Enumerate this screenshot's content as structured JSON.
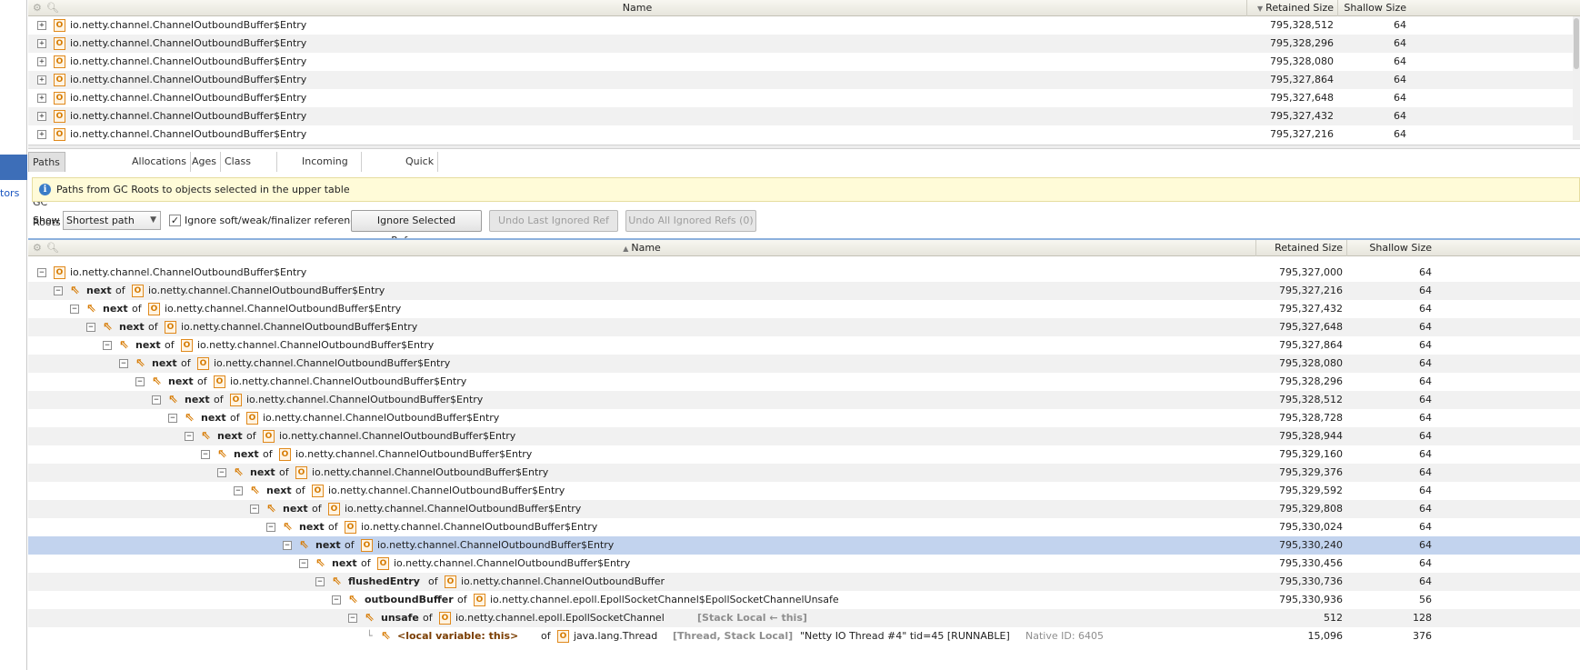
{
  "sidebar": {
    "link_fragment": "tors"
  },
  "upper_table": {
    "columns": {
      "name": "Name",
      "retained": "Retained Size",
      "shallow": "Shallow Size"
    },
    "rows": [
      {
        "name": "io.netty.channel.ChannelOutboundBuffer$Entry",
        "retained": "795,328,512",
        "shallow": "64"
      },
      {
        "name": "io.netty.channel.ChannelOutboundBuffer$Entry",
        "retained": "795,328,296",
        "shallow": "64"
      },
      {
        "name": "io.netty.channel.ChannelOutboundBuffer$Entry",
        "retained": "795,328,080",
        "shallow": "64"
      },
      {
        "name": "io.netty.channel.ChannelOutboundBuffer$Entry",
        "retained": "795,327,864",
        "shallow": "64"
      },
      {
        "name": "io.netty.channel.ChannelOutboundBuffer$Entry",
        "retained": "795,327,648",
        "shallow": "64"
      },
      {
        "name": "io.netty.channel.ChannelOutboundBuffer$Entry",
        "retained": "795,327,432",
        "shallow": "64"
      },
      {
        "name": "io.netty.channel.ChannelOutboundBuffer$Entry",
        "retained": "795,327,216",
        "shallow": "64"
      }
    ]
  },
  "tabs": [
    {
      "label": "Paths from GC Roots",
      "active": true
    },
    {
      "label": "Allocations"
    },
    {
      "label": "Ages"
    },
    {
      "label": "Class Hierarchy"
    },
    {
      "label": "Incoming References"
    },
    {
      "label": "Quick Info"
    }
  ],
  "info_text": "Paths from GC Roots to objects selected in the upper table",
  "controls": {
    "show_label": "Show",
    "show_value": "Shortest path",
    "ignore_checkbox_label": "Ignore soft/weak/finalizer references",
    "ignore_checked": true,
    "buttons": {
      "ignore_selected": "Ignore Selected Reference",
      "undo_last": "Undo Last Ignored Ref",
      "undo_all": "Undo All Ignored Refs (0)"
    }
  },
  "lower_table": {
    "columns": {
      "name": "Name",
      "retained": "Retained Size",
      "shallow": "Shallow Size"
    },
    "rows": [
      {
        "field": "",
        "of": "",
        "class": "io.netty.channel.ChannelOutboundBuffer$Entry",
        "extra": "",
        "note": "",
        "retained": "795,327,000",
        "shallow": "64"
      },
      {
        "field": "next",
        "of": "of",
        "class": "io.netty.channel.ChannelOutboundBuffer$Entry",
        "extra": "",
        "note": "",
        "retained": "795,327,216",
        "shallow": "64"
      },
      {
        "field": "next",
        "of": "of",
        "class": "io.netty.channel.ChannelOutboundBuffer$Entry",
        "extra": "",
        "note": "",
        "retained": "795,327,432",
        "shallow": "64"
      },
      {
        "field": "next",
        "of": "of",
        "class": "io.netty.channel.ChannelOutboundBuffer$Entry",
        "extra": "",
        "note": "",
        "retained": "795,327,648",
        "shallow": "64"
      },
      {
        "field": "next",
        "of": "of",
        "class": "io.netty.channel.ChannelOutboundBuffer$Entry",
        "extra": "",
        "note": "",
        "retained": "795,327,864",
        "shallow": "64"
      },
      {
        "field": "next",
        "of": "of",
        "class": "io.netty.channel.ChannelOutboundBuffer$Entry",
        "extra": "",
        "note": "",
        "retained": "795,328,080",
        "shallow": "64"
      },
      {
        "field": "next",
        "of": "of",
        "class": "io.netty.channel.ChannelOutboundBuffer$Entry",
        "extra": "",
        "note": "",
        "retained": "795,328,296",
        "shallow": "64"
      },
      {
        "field": "next",
        "of": "of",
        "class": "io.netty.channel.ChannelOutboundBuffer$Entry",
        "extra": "",
        "note": "",
        "retained": "795,328,512",
        "shallow": "64"
      },
      {
        "field": "next",
        "of": "of",
        "class": "io.netty.channel.ChannelOutboundBuffer$Entry",
        "extra": "",
        "note": "",
        "retained": "795,328,728",
        "shallow": "64"
      },
      {
        "field": "next",
        "of": "of",
        "class": "io.netty.channel.ChannelOutboundBuffer$Entry",
        "extra": "",
        "note": "",
        "retained": "795,328,944",
        "shallow": "64"
      },
      {
        "field": "next",
        "of": "of",
        "class": "io.netty.channel.ChannelOutboundBuffer$Entry",
        "extra": "",
        "note": "",
        "retained": "795,329,160",
        "shallow": "64"
      },
      {
        "field": "next",
        "of": "of",
        "class": "io.netty.channel.ChannelOutboundBuffer$Entry",
        "extra": "",
        "note": "",
        "retained": "795,329,376",
        "shallow": "64"
      },
      {
        "field": "next",
        "of": "of",
        "class": "io.netty.channel.ChannelOutboundBuffer$Entry",
        "extra": "",
        "note": "",
        "retained": "795,329,592",
        "shallow": "64"
      },
      {
        "field": "next",
        "of": "of",
        "class": "io.netty.channel.ChannelOutboundBuffer$Entry",
        "extra": "",
        "note": "",
        "retained": "795,329,808",
        "shallow": "64"
      },
      {
        "field": "next",
        "of": "of",
        "class": "io.netty.channel.ChannelOutboundBuffer$Entry",
        "extra": "",
        "note": "",
        "retained": "795,330,024",
        "shallow": "64"
      },
      {
        "field": "next",
        "of": "of",
        "class": "io.netty.channel.ChannelOutboundBuffer$Entry",
        "extra": "",
        "note": "",
        "retained": "795,330,240",
        "shallow": "64",
        "selected": true
      },
      {
        "field": "next",
        "of": "of",
        "class": "io.netty.channel.ChannelOutboundBuffer$Entry",
        "extra": "",
        "note": "",
        "retained": "795,330,456",
        "shallow": "64"
      },
      {
        "field": "flushedEntry",
        "of": "of",
        "class": "io.netty.channel.ChannelOutboundBuffer",
        "extra": "",
        "note": "",
        "retained": "795,330,736",
        "shallow": "64"
      },
      {
        "field": "outboundBuffer",
        "of": "of",
        "class": "io.netty.channel.epoll.EpollSocketChannel$EpollSocketChannelUnsafe",
        "extra": "",
        "note": "",
        "retained": "795,330,936",
        "shallow": "56"
      },
      {
        "field": "unsafe",
        "of": "of",
        "class": "io.netty.channel.epoll.EpollSocketChannel",
        "extra": "[Stack Local ← this]",
        "note": "",
        "retained": "512",
        "shallow": "128"
      },
      {
        "field": "<local variable: this>",
        "of": "of",
        "class": "java.lang.Thread",
        "extra": "[Thread, Stack Local]",
        "note": "\"Netty IO Thread #4\" tid=45 [RUNNABLE]",
        "native": "Native ID: 6405",
        "retained": "15,096",
        "shallow": "376",
        "leaf": true
      }
    ]
  },
  "colors": {
    "selection": "#c2d3ee",
    "object_icon": "#e0891c",
    "sidebar_selected": "#3d6eb8",
    "info_bg": "#fffbd8"
  },
  "icons": {
    "settings": "gear-icon",
    "search": "search-icon",
    "object": "object-icon",
    "reference": "reference-arrow-icon",
    "info": "info-icon"
  }
}
